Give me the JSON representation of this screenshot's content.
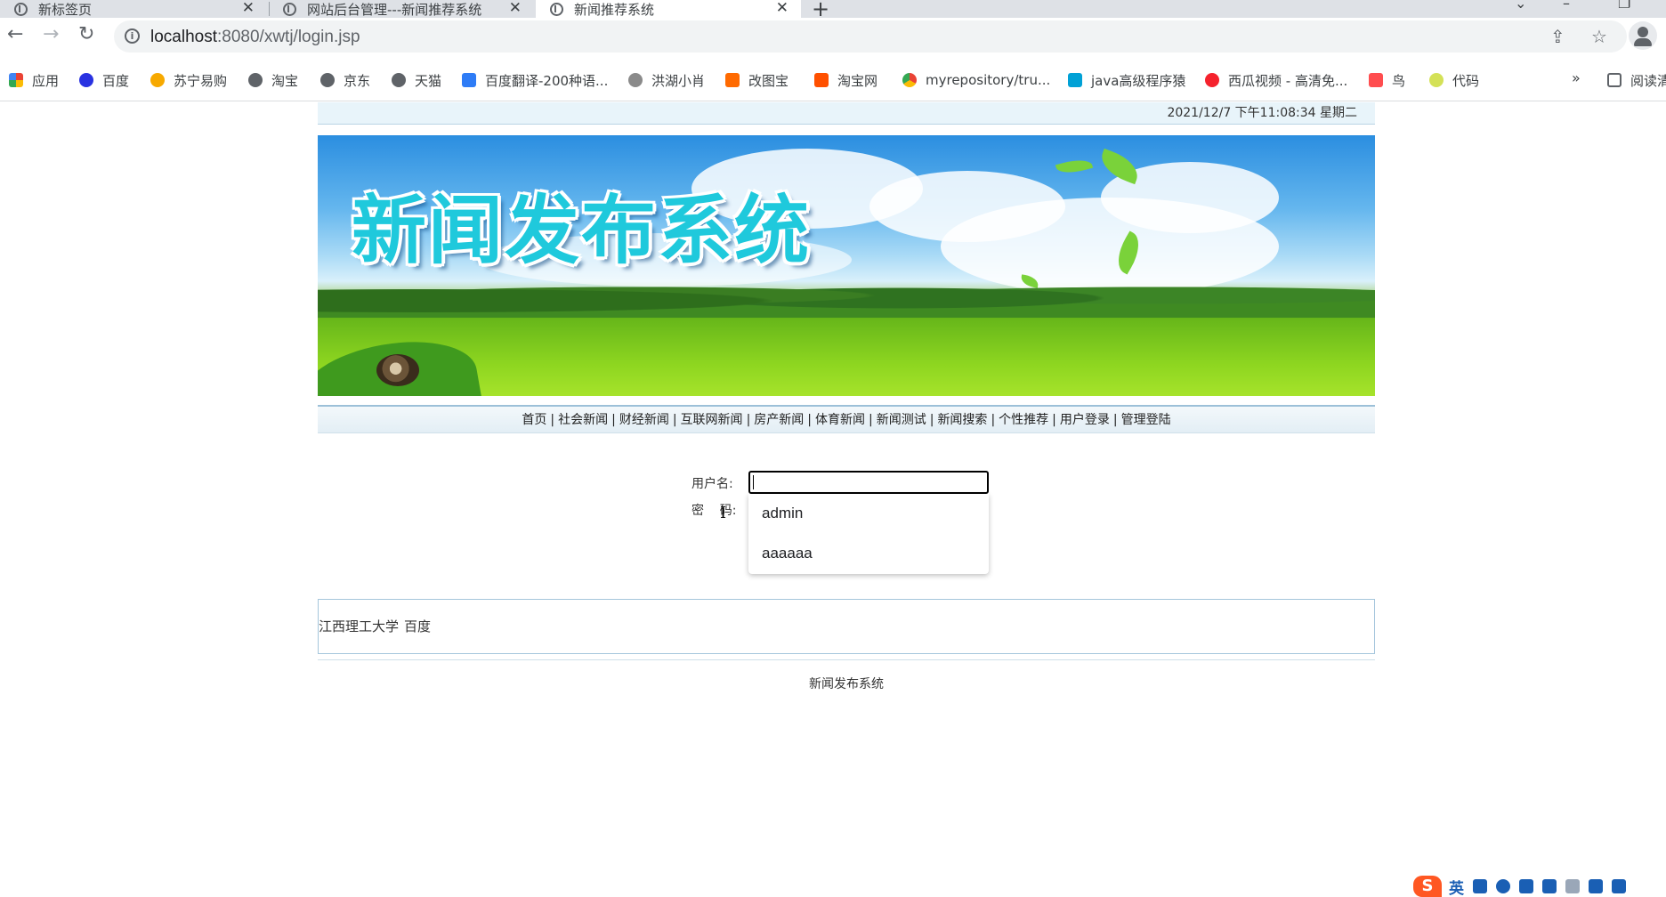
{
  "browser": {
    "tabs": [
      {
        "title": "新标签页"
      },
      {
        "title": "网站后台管理---新闻推荐系统"
      },
      {
        "title": "新闻推荐系统"
      }
    ],
    "url_host": "localhost",
    "url_rest": ":8080/xwtj/login.jsp",
    "bookmarks": [
      {
        "label": "应用",
        "color": "#e94235"
      },
      {
        "label": "百度",
        "color": "#2932e1"
      },
      {
        "label": "苏宁易购",
        "color": "#f7a900"
      },
      {
        "label": "淘宝",
        "color": "#5f6368"
      },
      {
        "label": "京东",
        "color": "#5f6368"
      },
      {
        "label": "天猫",
        "color": "#5f6368"
      },
      {
        "label": "百度翻译-200种语...",
        "color": "#2e7cf6"
      },
      {
        "label": "洪湖小肖",
        "color": "#8a8a8a"
      },
      {
        "label": "改图宝",
        "color": "#ff6a00"
      },
      {
        "label": "淘宝网",
        "color": "#ff5000"
      },
      {
        "label": "myrepository/tru...",
        "color": "#34a853"
      },
      {
        "label": "java高级程序猿",
        "color": "#00a1d6"
      },
      {
        "label": "西瓜视频 - 高清免...",
        "color": "#f5222d"
      },
      {
        "label": "鸟",
        "color": "#ff4d4f"
      },
      {
        "label": "代码",
        "color": "#d4e157"
      },
      {
        "label": "阅读清",
        "color": "#5f6368"
      }
    ],
    "bookmark_overflow": "»"
  },
  "page": {
    "datetime": "2021/12/7 下午11:08:34  星期二",
    "banner_title": "新闻发布系统",
    "nav": [
      "首页",
      "社会新闻",
      "财经新闻",
      "互联网新闻",
      "房产新闻",
      "体育新闻",
      "新闻测试",
      "新闻搜索",
      "个性推荐",
      "用户登录",
      "管理登陆"
    ],
    "nav_separator": "|",
    "login": {
      "username_label": "用户名:",
      "password_label": "密    码:",
      "username_value": "",
      "autocomplete": [
        "admin",
        "aaaaaa"
      ]
    },
    "links": [
      "江西理工大学",
      "百度"
    ],
    "footer": "新闻发布系统"
  },
  "ime": {
    "logo": "S",
    "lang": "英"
  }
}
